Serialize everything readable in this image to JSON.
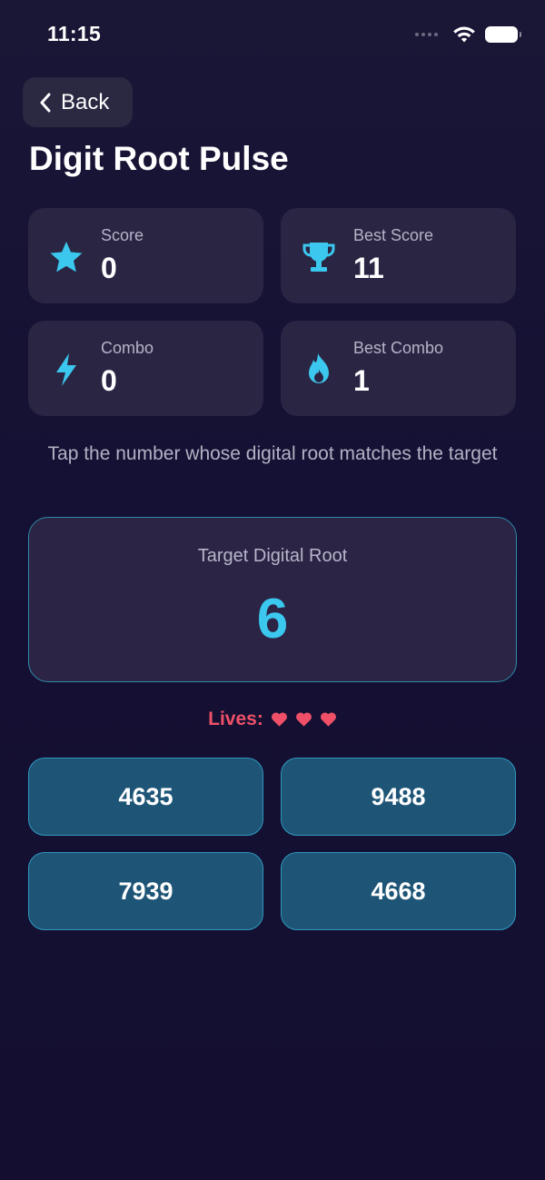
{
  "status_bar": {
    "time": "11:15"
  },
  "nav": {
    "back_label": "Back"
  },
  "page": {
    "title": "Digit Root Pulse"
  },
  "stats": {
    "score": {
      "label": "Score",
      "value": "0",
      "icon": "star-icon"
    },
    "best_score": {
      "label": "Best Score",
      "value": "11",
      "icon": "trophy-icon"
    },
    "combo": {
      "label": "Combo",
      "value": "0",
      "icon": "lightning-icon"
    },
    "best_combo": {
      "label": "Best Combo",
      "value": "1",
      "icon": "flame-icon"
    }
  },
  "instructions": "Tap the number whose digital root matches the target",
  "target": {
    "label": "Target Digital Root",
    "value": "6"
  },
  "lives": {
    "label": "Lives:",
    "count": 3
  },
  "answers": [
    "4635",
    "9488",
    "7939",
    "4668"
  ],
  "colors": {
    "accent": "#3bc7ee",
    "card": "#2a2543",
    "answer_bg": "#1e5577",
    "answer_border": "#2f96bd",
    "lives": "#ef5068"
  }
}
